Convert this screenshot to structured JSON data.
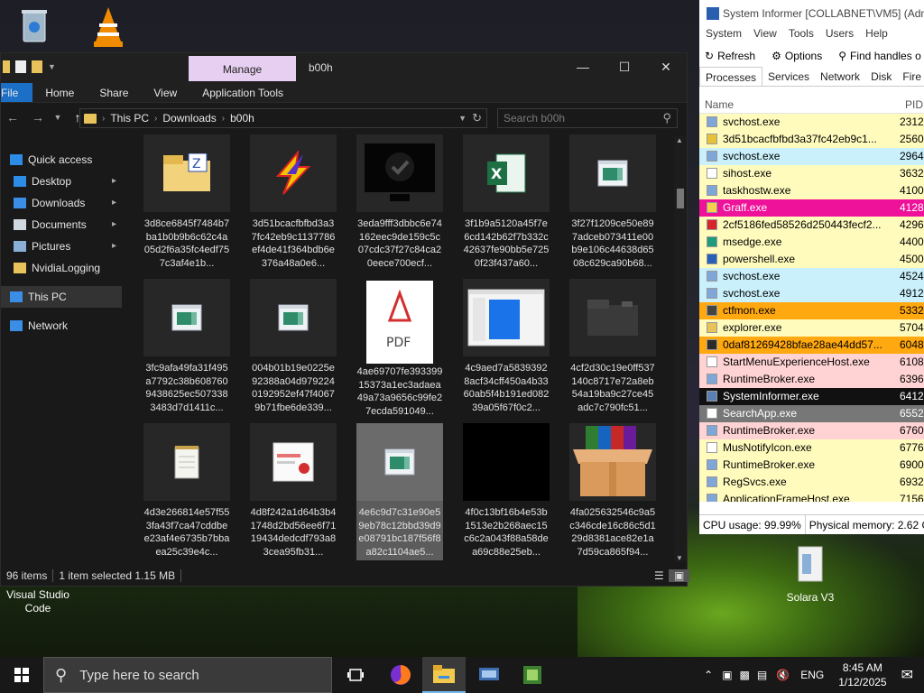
{
  "desktop": {
    "icons": [
      {
        "label": "Visual Studio\nCode",
        "name": "vscode"
      },
      {
        "label": "Solara V3",
        "name": "solara"
      }
    ]
  },
  "explorer": {
    "manage_label": "Manage",
    "window_title": "b00h",
    "ribbon_tabs": [
      "File",
      "Home",
      "Share",
      "View",
      "Application Tools"
    ],
    "breadcrumb": [
      "This PC",
      "Downloads",
      "b00h"
    ],
    "search_placeholder": "Search b00h",
    "nav_items": [
      {
        "label": "Quick access",
        "icon": "star-icon",
        "pinned": false,
        "indent": false,
        "selected": false
      },
      {
        "label": "Desktop",
        "icon": "desktop-icon",
        "pinned": true,
        "indent": true,
        "selected": false
      },
      {
        "label": "Downloads",
        "icon": "download-icon",
        "pinned": true,
        "indent": true,
        "selected": false
      },
      {
        "label": "Documents",
        "icon": "documents-icon",
        "pinned": true,
        "indent": true,
        "selected": false
      },
      {
        "label": "Pictures",
        "icon": "pictures-icon",
        "pinned": true,
        "indent": true,
        "selected": false
      },
      {
        "label": "NvidiaLogging",
        "icon": "folder-icon",
        "pinned": false,
        "indent": true,
        "selected": false
      },
      {
        "label": "This PC",
        "icon": "computer-icon",
        "pinned": false,
        "indent": false,
        "selected": true
      },
      {
        "label": "Network",
        "icon": "network-icon",
        "pinned": false,
        "indent": false,
        "selected": false
      }
    ],
    "files": [
      {
        "name": "3d8ce6845f7484b7ba1b0b9b6c62c4a05d2f6a35fc4edf757c3af4e1b...",
        "icon": "zip-folder-icon"
      },
      {
        "name": "3d51bcacfbfbd3a37fc42eb9c1137786ef4de41f364bdb6e376a48a0e6...",
        "icon": "lightning-icon"
      },
      {
        "name": "3eda9fff3dbbc6e74162eec9de159c5c07cdc37f27c84ca20eece700ecf...",
        "icon": "monitor-check-icon"
      },
      {
        "name": "3f1b9a5120a45f7e6cd142b62f7b332c42637fe90bb5e7250f23f437a60...",
        "icon": "excel-icon"
      },
      {
        "name": "3f27f1209ce50e897adceb073411e00b9e106c44638d6508c629ca90b68...",
        "icon": "app-window-icon"
      },
      {
        "name": "3fc9afa49fa31f495a7792c38b6087609438625ec5073383483d7d1411c...",
        "icon": "app-window-icon"
      },
      {
        "name": "004b01b19e0225e92388a04d9792240192952ef47f40679b71fbe6de339...",
        "icon": "app-window-icon"
      },
      {
        "name": "4ae69707fe39339915373a1ec3adaea49a73a9656c99fe27ecda591049...",
        "icon": "pdf-icon"
      },
      {
        "name": "4c9aed7a58393928acf34cff450a4b3360ab5f4b191ed08239a05f67f0c2...",
        "icon": "blue-window-icon"
      },
      {
        "name": "4cf2d30c19e0ff537140c8717e72a8eb54a19ba9c27ce45adc7c790fc51...",
        "icon": "dark-folder-icon"
      },
      {
        "name": "4d3e266814e57f553fa43f7ca47cddbee23af4e6735b7bbaea25c39e4c...",
        "icon": "notepad-icon"
      },
      {
        "name": "4d8f242a1d64b3b41748d2bd56ee6f7119434dedcdf793a83cea95fb31...",
        "icon": "certificate-icon"
      },
      {
        "name": "4e6c9d7c31e90e59eb78c12bbd39d9e08791bc187f56f8a82c1104ae5...",
        "icon": "app-window-icon"
      },
      {
        "name": "4f0c13bf16b4e53b1513e2b268aec15c6c2a043f88a58dea69c88e25eb...",
        "icon": "black-image-icon"
      },
      {
        "name": "4fa025632546c9a5c346cde16c86c5d129d8381ace82e1a7d59ca865f94...",
        "icon": "installer-box-icon"
      }
    ],
    "selected_index": 12,
    "status": {
      "items": "96 items",
      "selected": "1 item selected  1.15 MB"
    }
  },
  "sysinfo": {
    "title": "System Informer [COLLABNET\\VM5] (Adm",
    "menu": [
      "System",
      "View",
      "Tools",
      "Users",
      "Help"
    ],
    "toolbar": {
      "refresh": "Refresh",
      "options": "Options",
      "find": "Find handles o"
    },
    "tabs": [
      "Processes",
      "Services",
      "Network",
      "Disk",
      "Fire"
    ],
    "columns": {
      "name": "Name",
      "pid": "PID"
    },
    "processes": [
      {
        "name": "svchost.exe",
        "pid": "2312",
        "bg": "#fffbbd",
        "fg": "#000000",
        "icon": "#7fa6d6"
      },
      {
        "name": "3d51bcacfbfbd3a37fc42eb9c1...",
        "pid": "2560",
        "bg": "#fffbbd",
        "fg": "#000000",
        "icon": "#e6c23a"
      },
      {
        "name": "svchost.exe",
        "pid": "2964",
        "bg": "#c9f0fb",
        "fg": "#000000",
        "icon": "#7fa6d6"
      },
      {
        "name": "sihost.exe",
        "pid": "3632",
        "bg": "#fffbbd",
        "fg": "#000000",
        "icon": "#ffffff"
      },
      {
        "name": "taskhostw.exe",
        "pid": "4100",
        "bg": "#fffbbd",
        "fg": "#000000",
        "icon": "#7fa6d6"
      },
      {
        "name": "Graff.exe",
        "pid": "4128",
        "bg": "#ee1199",
        "fg": "#ffffff",
        "icon": "#f5d04a"
      },
      {
        "name": "2cf5186fed58526d250443fecf2...",
        "pid": "4296",
        "bg": "#fffbbd",
        "fg": "#000000",
        "icon": "#d7262b"
      },
      {
        "name": "msedge.exe",
        "pid": "4400",
        "bg": "#fffbbd",
        "fg": "#000000",
        "icon": "#1f9a7a"
      },
      {
        "name": "powershell.exe",
        "pid": "4500",
        "bg": "#fffbbd",
        "fg": "#000000",
        "icon": "#2860b8"
      },
      {
        "name": "svchost.exe",
        "pid": "4524",
        "bg": "#c9f0fb",
        "fg": "#000000",
        "icon": "#7fa6d6"
      },
      {
        "name": "svchost.exe",
        "pid": "4912",
        "bg": "#c9f0fb",
        "fg": "#000000",
        "icon": "#7fa6d6"
      },
      {
        "name": "ctfmon.exe",
        "pid": "5332",
        "bg": "#ffa80f",
        "fg": "#000000",
        "icon": "#444444"
      },
      {
        "name": "explorer.exe",
        "pid": "5704",
        "bg": "#fffbbd",
        "fg": "#000000",
        "icon": "#e8c25a"
      },
      {
        "name": "0daf81269428bfae28ae44dd57...",
        "pid": "6048",
        "bg": "#ffa80f",
        "fg": "#000000",
        "icon": "#2b2b2b"
      },
      {
        "name": "StartMenuExperienceHost.exe",
        "pid": "6108",
        "bg": "#ffd3d3",
        "fg": "#000000",
        "icon": "#ffffff"
      },
      {
        "name": "RuntimeBroker.exe",
        "pid": "6396",
        "bg": "#ffd3d3",
        "fg": "#000000",
        "icon": "#7fa6d6"
      },
      {
        "name": "SystemInformer.exe",
        "pid": "6412",
        "bg": "#111111",
        "fg": "#ffffff",
        "icon": "#5a7fb5"
      },
      {
        "name": "SearchApp.exe",
        "pid": "6552",
        "bg": "#777777",
        "fg": "#ffffff",
        "icon": "#ffffff"
      },
      {
        "name": "RuntimeBroker.exe",
        "pid": "6760",
        "bg": "#ffd3d3",
        "fg": "#000000",
        "icon": "#7fa6d6"
      },
      {
        "name": "MusNotifyIcon.exe",
        "pid": "6776",
        "bg": "#fffbbd",
        "fg": "#000000",
        "icon": "#ffffff"
      },
      {
        "name": "RuntimeBroker.exe",
        "pid": "6900",
        "bg": "#fffbbd",
        "fg": "#000000",
        "icon": "#7fa6d6"
      },
      {
        "name": "RegSvcs.exe",
        "pid": "6932",
        "bg": "#fffbbd",
        "fg": "#000000",
        "icon": "#7fa6d6"
      },
      {
        "name": "ApplicationFrameHost.exe",
        "pid": "7156",
        "bg": "#fffbbd",
        "fg": "#000000",
        "icon": "#7fa6d6"
      }
    ],
    "status": {
      "cpu": "CPU usage: 99.99%",
      "memory": "Physical memory: 2.62 G"
    }
  },
  "taskbar": {
    "search_placeholder": "Type here to search",
    "tray": {
      "lang": "ENG",
      "time": "8:45 AM",
      "date": "1/12/2025"
    }
  }
}
